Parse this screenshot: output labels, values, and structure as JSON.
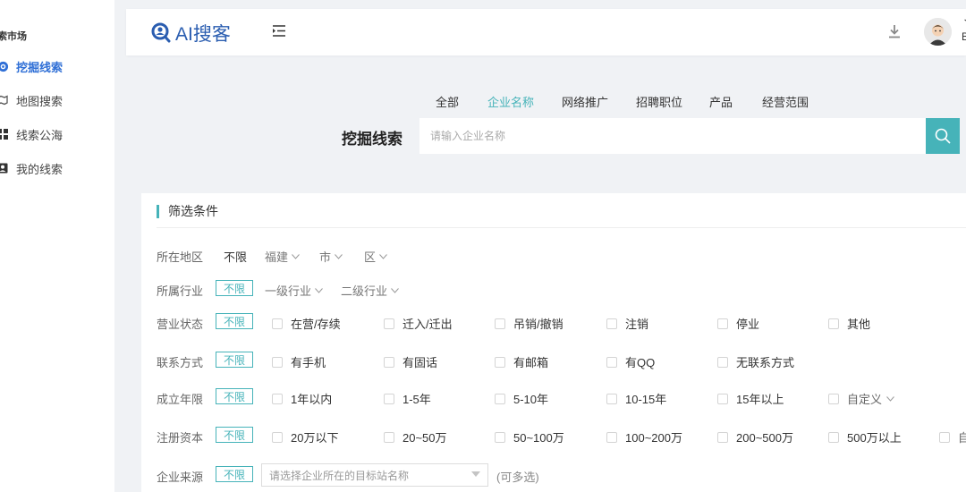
{
  "sidebar": {
    "title": "索市场",
    "items": [
      {
        "label": "挖掘线索",
        "icon": "target-icon",
        "active": true
      },
      {
        "label": "地图搜索",
        "icon": "map-pin-icon",
        "active": false
      },
      {
        "label": "线索公海",
        "icon": "grid-icon",
        "active": false
      },
      {
        "label": "我的线索",
        "icon": "contact-card-icon",
        "active": false
      }
    ]
  },
  "header": {
    "logo_text": "AI搜客",
    "user_name_line1": "丶",
    "user_name_line2": "B"
  },
  "search": {
    "tabs": [
      "全部",
      "企业名称",
      "网络推广",
      "招聘职位",
      "产品",
      "经营范围"
    ],
    "active_tab": "企业名称",
    "label": "挖掘线索",
    "placeholder": "请输入企业名称"
  },
  "filters": {
    "title": "筛选条件",
    "unlimited": "不限",
    "region": {
      "label": "所在地区",
      "province": "福建",
      "city": "市",
      "district": "区"
    },
    "industry": {
      "label": "所属行业",
      "level1": "一级行业",
      "level2": "二级行业"
    },
    "status": {
      "label": "营业状态",
      "options": [
        "在营/存续",
        "迁入/迁出",
        "吊销/撤销",
        "注销",
        "停业",
        "其他"
      ]
    },
    "contact": {
      "label": "联系方式",
      "options": [
        "有手机",
        "有固话",
        "有邮箱",
        "有QQ",
        "无联系方式"
      ]
    },
    "years": {
      "label": "成立年限",
      "options": [
        "1年以内",
        "1-5年",
        "5-10年",
        "10-15年",
        "15年以上",
        "自定义"
      ]
    },
    "capital": {
      "label": "注册资本",
      "options": [
        "20万以下",
        "20~50万",
        "50~100万",
        "100~200万",
        "200~500万",
        "500万以上",
        "自"
      ]
    },
    "source": {
      "label": "企业来源",
      "placeholder": "请选择企业所在的目标站名称",
      "hint": "(可多选)"
    }
  },
  "colors": {
    "accent": "#46b3b9",
    "brand": "#2a5db0",
    "active_nav": "#2f6fd6"
  }
}
